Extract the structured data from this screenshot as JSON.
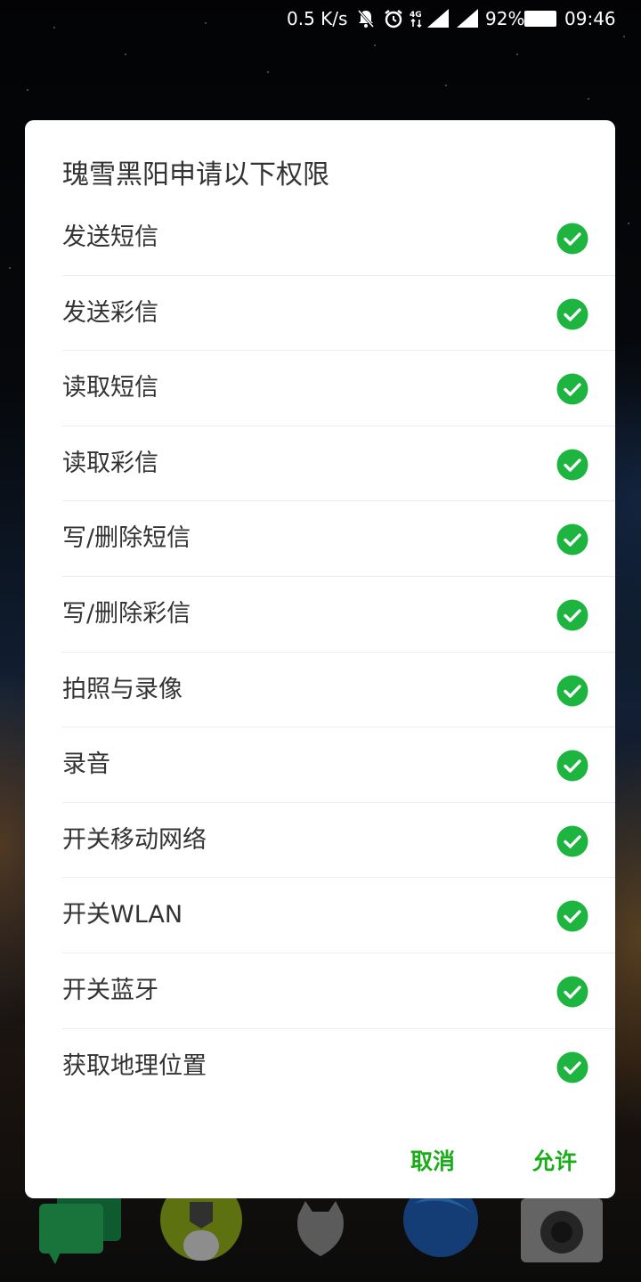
{
  "status_bar": {
    "network_speed": "0.5 K/s",
    "battery_percent": "92%",
    "time": "09:46",
    "icons": [
      "mute-bell-icon",
      "alarm-icon",
      "4g-data-icon",
      "signal-icon",
      "signal-icon",
      "battery-icon"
    ]
  },
  "dialog": {
    "title": "瑰雪黑阳申请以下权限",
    "permissions": [
      {
        "label": "发送短信",
        "checked": true
      },
      {
        "label": "发送彩信",
        "checked": true
      },
      {
        "label": "读取短信",
        "checked": true
      },
      {
        "label": "读取彩信",
        "checked": true
      },
      {
        "label": "写/删除短信",
        "checked": true
      },
      {
        "label": "写/删除彩信",
        "checked": true
      },
      {
        "label": "拍照与录像",
        "checked": true
      },
      {
        "label": "录音",
        "checked": true
      },
      {
        "label": "开关移动网络",
        "checked": true
      },
      {
        "label": "开关WLAN",
        "checked": true
      },
      {
        "label": "开关蓝牙",
        "checked": true
      },
      {
        "label": "获取地理位置",
        "checked": true
      }
    ],
    "cancel_label": "取消",
    "allow_label": "允许"
  },
  "colors": {
    "accent": "#1aad19",
    "check_green": "#1db440",
    "text": "#333333"
  }
}
